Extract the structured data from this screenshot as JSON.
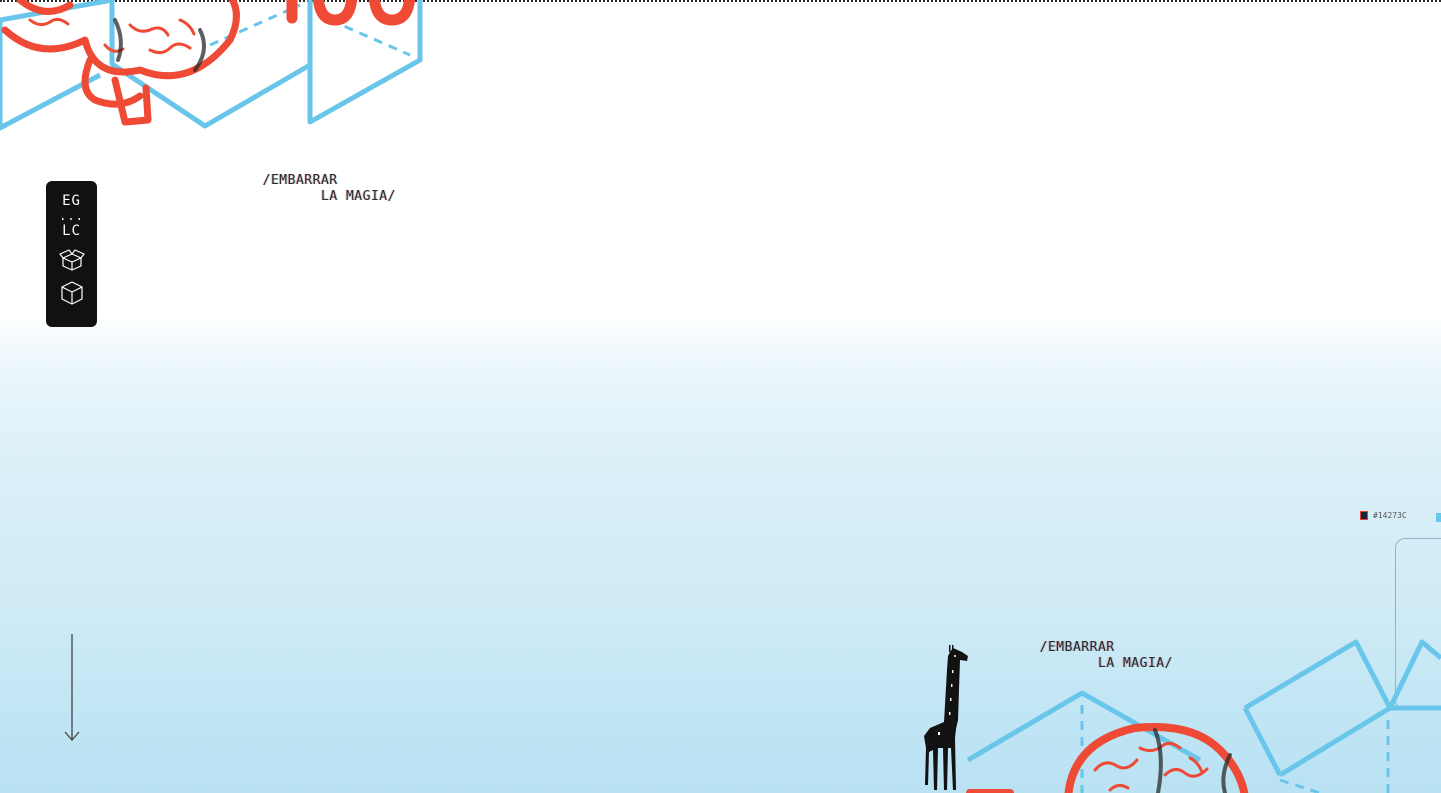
{
  "colors": {
    "accent_red": "#ee4a35",
    "accent_blue": "#69c6ea",
    "dark": "#111111",
    "background_bottom": "#b9e2f3"
  },
  "top_art": {
    "text_fragment": "YOU"
  },
  "tagline_top": {
    "line1": "/EMBARRAR",
    "line2": "LA MAGIA/"
  },
  "tagline_bottom": {
    "line1": "/EMBARRAR",
    "line2": "LA MAGIA/"
  },
  "nav": {
    "logo_top": "EG",
    "logo_dots": "...",
    "logo_bottom": "LC",
    "buttons": [
      {
        "icon": "open-box-icon"
      },
      {
        "icon": "cube-icon"
      }
    ]
  },
  "scroll_hint": {
    "icon": "arrow-down-icon"
  },
  "color_swatch": {
    "label": "#14273C",
    "color": "#14273c"
  }
}
